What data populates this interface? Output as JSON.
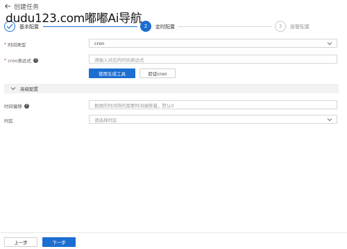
{
  "watermark": "dudu123.com嘟嘟Ai导航",
  "header": {
    "title": "创建任务"
  },
  "steps": [
    {
      "number": "1",
      "label": "基本配置",
      "status": "done"
    },
    {
      "number": "2",
      "label": "定时配置",
      "status": "active"
    },
    {
      "number": "3",
      "label": "报警配置",
      "status": "pending"
    }
  ],
  "form": {
    "time_type": {
      "label": "时间类型",
      "value": "cron"
    },
    "cron_expression": {
      "label": "cron表达式",
      "placeholder": "请输入对应的时间表达式"
    },
    "use_generator_button": "使用生成工具",
    "validate_cron_button": "验证cron",
    "advanced": {
      "label": "高级配置"
    },
    "time_offset": {
      "label": "时间偏移",
      "placeholder": "数据的时间快的需要时间偏移量，默认0"
    },
    "timezone": {
      "label": "时区",
      "placeholder": "请选择时区"
    }
  },
  "footer": {
    "prev_button": "上一步",
    "next_button": "下一步"
  },
  "colors": {
    "accent": "#1c6ed1",
    "required": "#d9453a"
  }
}
